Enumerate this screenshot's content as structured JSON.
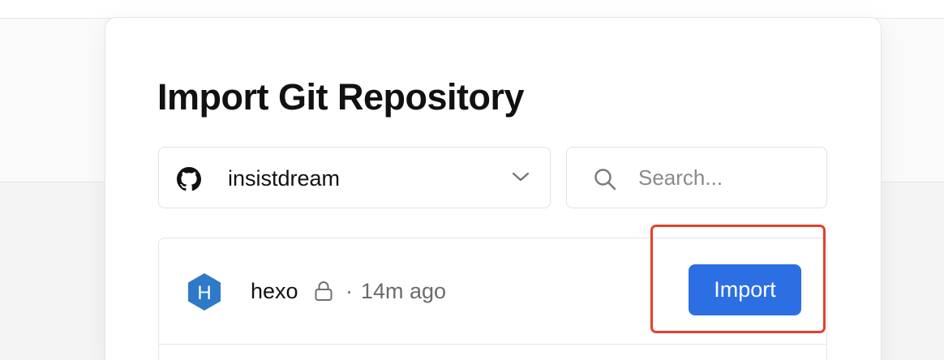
{
  "page": {
    "title": "Import Git Repository"
  },
  "account": {
    "name": "insistdream",
    "icon": "github-icon"
  },
  "search": {
    "value": "",
    "placeholder": "Search..."
  },
  "repositories": [
    {
      "name": "hexo",
      "icon": "hexo-icon",
      "icon_letter": "H",
      "private": true,
      "separator": "·",
      "updated": "14m ago",
      "action_label": "Import"
    }
  ],
  "colors": {
    "accent": "#2b6fe3",
    "highlight": "#e5402c",
    "hexo_brand": "#2f79c9"
  }
}
